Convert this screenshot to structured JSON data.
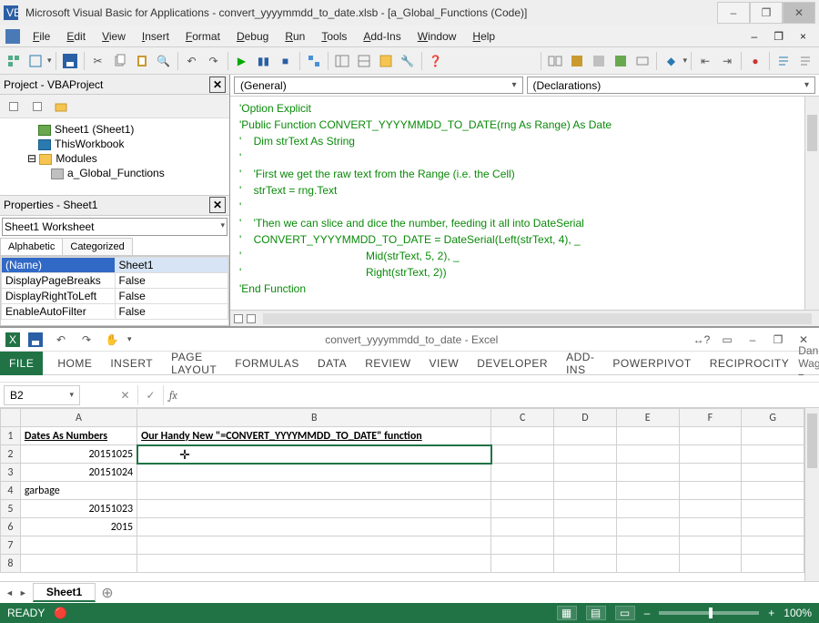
{
  "vba": {
    "icon_label": "VBA",
    "title": "Microsoft Visual Basic for Applications - convert_yyyymmdd_to_date.xlsb - [a_Global_Functions (Code)]",
    "menubar": [
      "File",
      "Edit",
      "View",
      "Insert",
      "Format",
      "Debug",
      "Run",
      "Tools",
      "Add-Ins",
      "Window",
      "Help"
    ],
    "inner_win_btns": [
      "–",
      "❐",
      "×"
    ],
    "project_panel": {
      "title": "Project - VBAProject",
      "tree": [
        {
          "indent": "node",
          "icon": "ico-sheet",
          "label": "Sheet1 (Sheet1)"
        },
        {
          "indent": "node",
          "icon": "ico-book",
          "label": "ThisWorkbook"
        },
        {
          "indent": "mod",
          "icon": "ico-folder",
          "label": "Modules",
          "prefix": "⊟ "
        },
        {
          "indent": "leaf",
          "icon": "ico-mod",
          "label": "a_Global_Functions"
        }
      ]
    },
    "props_panel": {
      "title": "Properties - Sheet1",
      "combo": "Sheet1  Worksheet",
      "tabs": [
        "Alphabetic",
        "Categorized"
      ],
      "rows": [
        {
          "k": "(Name)",
          "v": "Sheet1",
          "sel": true
        },
        {
          "k": "DisplayPageBreaks",
          "v": "False"
        },
        {
          "k": "DisplayRightToLeft",
          "v": "False"
        },
        {
          "k": "EnableAutoFilter",
          "v": "False"
        }
      ]
    },
    "code": {
      "dd_left": "(General)",
      "dd_right": "(Declarations)",
      "lines": [
        "'Option Explicit",
        "'Public Function CONVERT_YYYYMMDD_TO_DATE(rng As Range) As Date",
        "'    Dim strText As String",
        "'",
        "'    'First we get the raw text from the Range (i.e. the Cell)",
        "'    strText = rng.Text",
        "'",
        "'    'Then we can slice and dice the number, feeding it all into DateSerial",
        "'    CONVERT_YYYYMMDD_TO_DATE = DateSerial(Left(strText, 4), _",
        "'                                         Mid(strText, 5, 2), _",
        "'                                         Right(strText, 2))",
        "'End Function"
      ]
    }
  },
  "excel": {
    "qat_title": "convert_yyyymmdd_to_date - Excel",
    "tabs": [
      "FILE",
      "HOME",
      "INSERT",
      "PAGE LAYOUT",
      "FORMULAS",
      "DATA",
      "REVIEW",
      "VIEW",
      "DEVELOPER",
      "ADD-INS",
      "POWERPIVOT",
      "RECIPROCITY"
    ],
    "user": "Dan Wagn...",
    "namebox": "B2",
    "fx": "fx",
    "columns": [
      "A",
      "B",
      "C",
      "D",
      "E",
      "F",
      "G"
    ],
    "headers": {
      "a": "Dates As Numbers",
      "b": "Our Handy New \"=CONVERT_YYYYMMDD_TO_DATE\" function"
    },
    "rows": [
      {
        "n": "1"
      },
      {
        "n": "2",
        "a": "20151025"
      },
      {
        "n": "3",
        "a": "20151024"
      },
      {
        "n": "4",
        "a": "garbage",
        "align": "left"
      },
      {
        "n": "5",
        "a": "20151023"
      },
      {
        "n": "6",
        "a": "2015"
      },
      {
        "n": "7"
      },
      {
        "n": "8"
      }
    ],
    "sheet_tab": "Sheet1",
    "add_sheet": "⊕",
    "status": "READY",
    "zoom": "100%",
    "touch_icon": "↔?",
    "rec_icon": "🔴",
    "nav_prev": "◄",
    "nav_next": "►"
  }
}
